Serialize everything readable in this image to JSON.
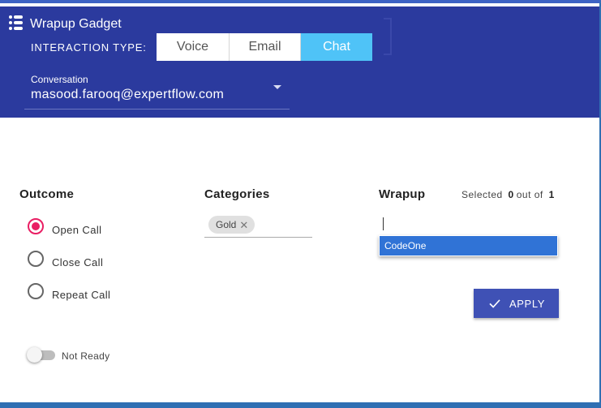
{
  "app": {
    "title": "Wrapup Gadget",
    "menu_icon": "menu-icon"
  },
  "interaction_type": {
    "label": "INTERACTION TYPE:",
    "tabs": [
      {
        "label": "Voice",
        "selected": false
      },
      {
        "label": "Email",
        "selected": false
      },
      {
        "label": "Chat",
        "selected": true
      }
    ]
  },
  "conversation": {
    "label": "Conversation",
    "selected_value": "masood.farooq@expertflow.com"
  },
  "outcome": {
    "title": "Outcome",
    "options": [
      {
        "label": "Open Call",
        "checked": true
      },
      {
        "label": "Close Call",
        "checked": false
      },
      {
        "label": "Repeat Call",
        "checked": false
      }
    ]
  },
  "not_ready": {
    "label": "Not Ready",
    "on": false
  },
  "categories": {
    "title": "Categories",
    "chips": [
      {
        "label": "Gold",
        "remove_icon": "close-icon"
      }
    ]
  },
  "wrapup": {
    "title": "Wrapup",
    "selected_prefix": "Selected",
    "selected_count": "0",
    "selected_mid": "out of",
    "selected_total": "1",
    "input_value": "",
    "dropdown_items": [
      {
        "label": "CodeOne",
        "highlighted": true
      }
    ]
  },
  "apply": {
    "label": "APPLY",
    "icon": "check-icon"
  },
  "colors": {
    "header_bg": "#2b3a9e",
    "tab_selected": "#4fc3f7",
    "radio_checked": "#e91e63",
    "apply_bg": "#3f51b5",
    "dropdown_highlight": "#3073d6"
  }
}
